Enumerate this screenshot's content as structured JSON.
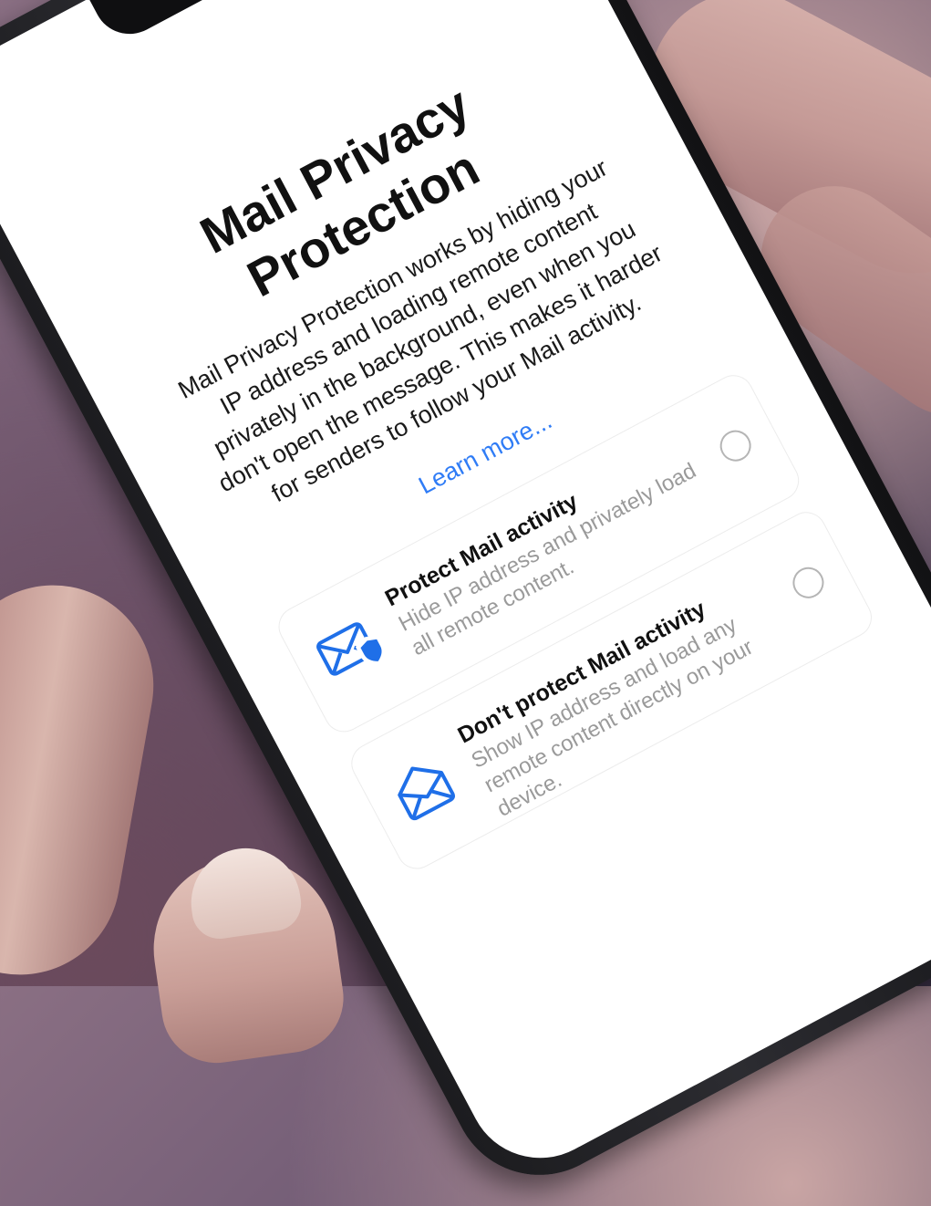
{
  "screen": {
    "title": "Mail Privacy Protection",
    "body": "Mail Privacy Protection works by hiding your IP address and loading remote content privately in the background, even when you don't open the message. This makes it harder for senders to follow your Mail activity.",
    "learn_more": "Learn more...",
    "options": [
      {
        "title": "Protect Mail activity",
        "description": "Hide IP address and privately load all remote content.",
        "icon": "envelope-shield-icon",
        "selected": false
      },
      {
        "title": "Don't protect Mail activity",
        "description": "Show IP address and load any remote content directly on your device.",
        "icon": "open-envelope-icon",
        "selected": false
      }
    ]
  },
  "colors": {
    "accent": "#2f7cf6",
    "icon_blue": "#1f6fe8"
  }
}
